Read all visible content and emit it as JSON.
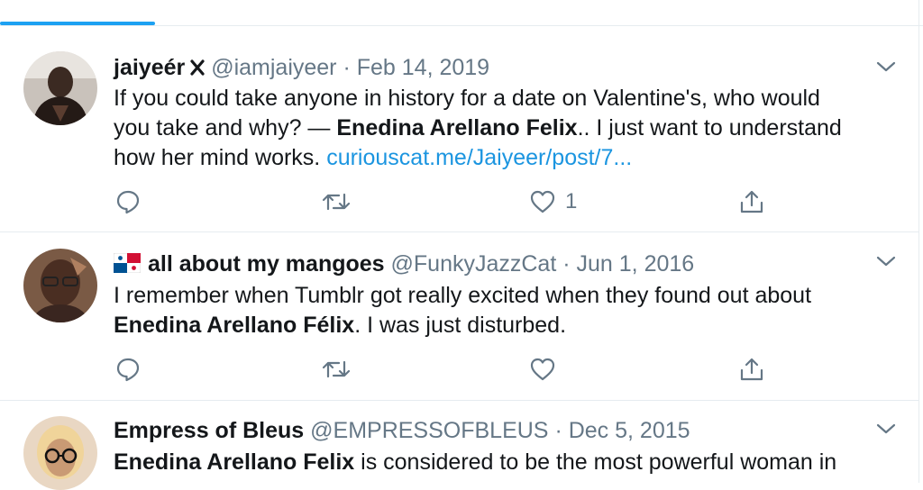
{
  "tweets": [
    {
      "name": "jaiyeér",
      "handle": "@iamjaiyeer",
      "sep": "·",
      "date": "Feb 14, 2019",
      "name_icon": "x-mark-icon",
      "body_lines": [
        {
          "text": "If you could take anyone in history for a date on Valentine's, who would"
        },
        {
          "text": "you take and why? — ",
          "bold": "Enedina Arellano Felix",
          "after": ".. I just want to understand"
        },
        {
          "text": "how her mind works. ",
          "link": "curiouscat.me/Jaiyeer/post/7..."
        }
      ],
      "like_count": "1"
    },
    {
      "name": "all about my mangoes",
      "handle": "@FunkyJazzCat",
      "sep": "·",
      "date": "Jun 1, 2016",
      "name_icon": "panama-flag-icon",
      "body_lines": [
        {
          "text": "I remember when Tumblr got really excited when they found out about"
        },
        {
          "bold": "Enedina Arellano Félix",
          "after": ". I was just disturbed."
        }
      ],
      "like_count": ""
    },
    {
      "name": "Empress of Bleus",
      "handle": "@EMPRESSOFBLEUS",
      "sep": "·",
      "date": "Dec 5, 2015",
      "body_lines": [
        {
          "bold": "Enedina Arellano Felix",
          "after": " is considered to be the most powerful woman in"
        }
      ]
    }
  ],
  "colors": {
    "accent": "#1da1f2",
    "link": "#1b95e0",
    "muted": "#657786",
    "text": "#14171a",
    "border": "#e6ecf0"
  }
}
